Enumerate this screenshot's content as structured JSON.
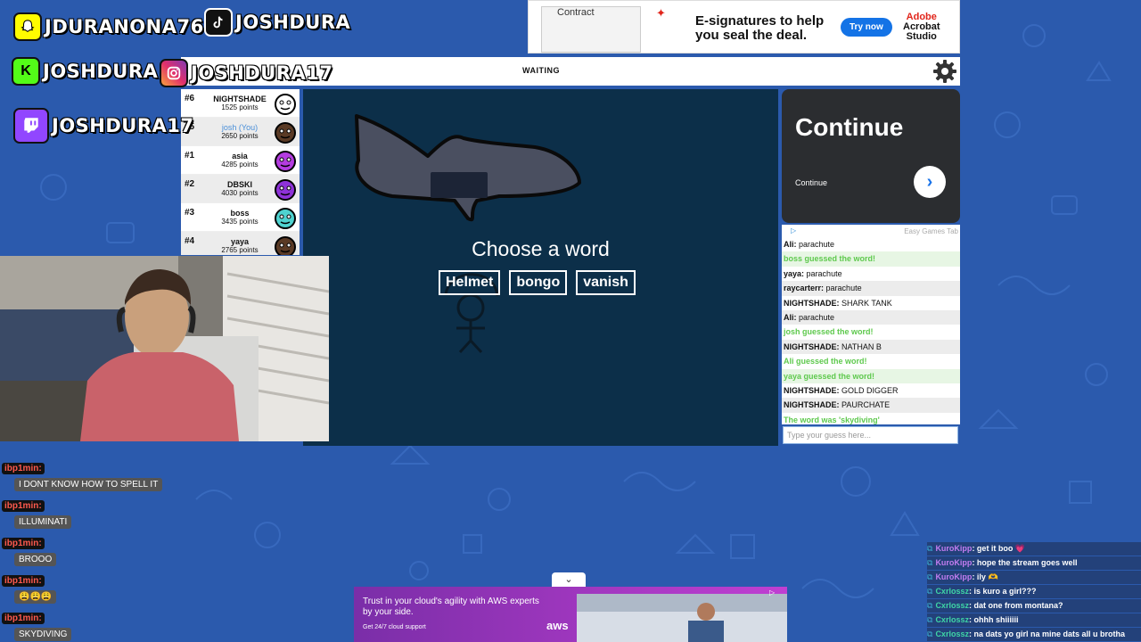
{
  "social": {
    "snapchat": "JDURANONA76",
    "tiktok": "JOSHDURA",
    "kick": "JOSHDURA",
    "instagram": "JOSHDURA17",
    "twitch": "JOSHDURA17",
    "kick_letter": "K"
  },
  "top_ad": {
    "doc_title": "Contract",
    "headline": "E-signatures to help you seal the deal.",
    "cta": "Try now",
    "brand_line1": "Adobe",
    "brand_line2": "Acrobat",
    "brand_line3": "Studio"
  },
  "header": {
    "status": "WAITING"
  },
  "players": [
    {
      "rank": "#6",
      "name": "NIGHTSHADE",
      "points": "1525 points",
      "you": false,
      "color": "#ffffff"
    },
    {
      "rank": "#5",
      "name": "josh (You)",
      "points": "2650 points",
      "you": true,
      "color": "#5a3a25"
    },
    {
      "rank": "#1",
      "name": "asia",
      "points": "4285 points",
      "you": false,
      "color": "#b43ce0"
    },
    {
      "rank": "#2",
      "name": "DBSKI",
      "points": "4030 points",
      "you": false,
      "color": "#8e32d8"
    },
    {
      "rank": "#3",
      "name": "boss",
      "points": "3435 points",
      "you": false,
      "color": "#4fd3d0"
    },
    {
      "rank": "#4",
      "name": "yaya",
      "points": "2765 points",
      "you": false,
      "color": "#5a3a25"
    }
  ],
  "canvas": {
    "prompt": "Choose a word",
    "words": [
      "Helmet",
      "bongo",
      "vanish"
    ]
  },
  "right_ad": {
    "headline": "Continue",
    "sub": "Continue",
    "arrow": "›",
    "tab_label": "Easy Games Tab"
  },
  "chat": [
    {
      "who": "Ali:",
      "text": "parachute",
      "guessed": false
    },
    {
      "who": "",
      "text": "boss guessed the word!",
      "guessed": true
    },
    {
      "who": "yaya:",
      "text": "parachute",
      "guessed": false
    },
    {
      "who": "raycarterr:",
      "text": "parachute",
      "guessed": false
    },
    {
      "who": "NIGHTSHADE:",
      "text": "SHARK TANK",
      "guessed": false
    },
    {
      "who": "Ali:",
      "text": "parachute",
      "guessed": false
    },
    {
      "who": "",
      "text": "josh guessed the word!",
      "guessed": true
    },
    {
      "who": "NIGHTSHADE:",
      "text": "NATHAN B",
      "guessed": false
    },
    {
      "who": "",
      "text": "Ali guessed the word!",
      "guessed": true
    },
    {
      "who": "",
      "text": "yaya guessed the word!",
      "guessed": true
    },
    {
      "who": "NIGHTSHADE:",
      "text": "GOLD DIGGER",
      "guessed": false
    },
    {
      "who": "NIGHTSHADE:",
      "text": "PAURCHATE",
      "guessed": false
    },
    {
      "who": "",
      "text": "The word was 'skydiving'",
      "guessed": true
    }
  ],
  "guess_placeholder": "Type your guess here...",
  "stream_chat_left": [
    {
      "user": "ibp1min:",
      "text": "I DONT KNOW HOW TO SPELL IT"
    },
    {
      "user": "ibp1min:",
      "text": "ILLUMINATI"
    },
    {
      "user": "ibp1min:",
      "text": "BROOO"
    },
    {
      "user": "ibp1min:",
      "text": "😩😩😩"
    },
    {
      "user": "ibp1min:",
      "text": "SKYDIVING"
    }
  ],
  "stream_chat_right": [
    {
      "user": "KuroKipp",
      "text": ": get it boo 💗",
      "style": "u1"
    },
    {
      "user": "KuroKipp",
      "text": ": hope the stream goes well",
      "style": "u1"
    },
    {
      "user": "KuroKipp",
      "text": ": ily 🫶",
      "style": "u1"
    },
    {
      "user": "Cxrlossz",
      "text": ": is kuro a girl???",
      "style": "u2"
    },
    {
      "user": "Cxrlossz",
      "text": ": dat one from montana?",
      "style": "u2"
    },
    {
      "user": "Cxrlossz",
      "text": ": ohhh shiiiiii",
      "style": "u2"
    },
    {
      "user": "Cxrlossz",
      "text": ": na dats yo girl na mine dats all u brotha",
      "style": "u2"
    }
  ],
  "bottom_ad": {
    "line1": "Trust in your cloud's agility with AWS experts by your side.",
    "line2": "Get 24/7 cloud support",
    "brand": "aws",
    "toggle": "⌄"
  },
  "colors": {
    "background": "#2b5aad",
    "canvas": "#0c2f49",
    "guessed": "#5ec94d",
    "you": "#4a8fd8"
  }
}
